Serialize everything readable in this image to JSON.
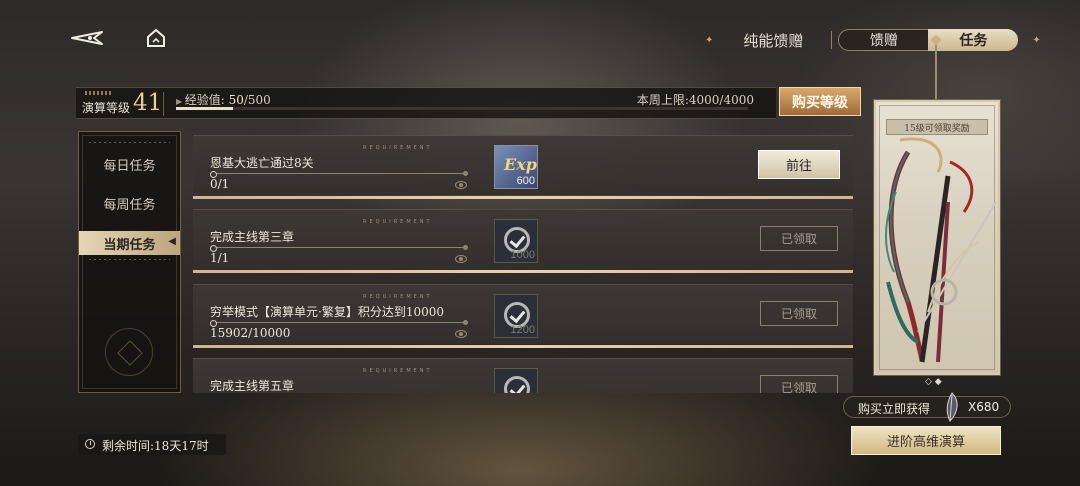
{
  "top_tabs": {
    "chip_energy": "纯能馈赠",
    "gift": "馈赠",
    "task": "任务"
  },
  "level": {
    "label": "演算等级",
    "value": "41"
  },
  "xp": {
    "label": "经验值:",
    "current": "50",
    "sep": "/",
    "max": "500",
    "progress": 0.1
  },
  "weekly": {
    "label": "本周上限:",
    "current": "4000",
    "sep": "/",
    "max": "4000"
  },
  "buy_level_label": "购买等级",
  "nav": [
    {
      "label": "每日任务"
    },
    {
      "label": "每周任务"
    },
    {
      "label": "当期任务"
    }
  ],
  "requirement_tag": "REQUIREMENT",
  "tasks": [
    {
      "name": "恩基大逃亡通过8关",
      "progress": "0/1",
      "reward_qty": "600",
      "reward_icon": "exp-icon",
      "action": "前往"
    },
    {
      "name": "完成主线第三章",
      "progress": "1/1",
      "reward_qty": "1000",
      "reward_icon": "points-icon",
      "action": "已领取"
    },
    {
      "name": "穷举模式【演算单元·繁复】积分达到10000",
      "progress": "15902/10000",
      "reward_qty": "1200",
      "reward_icon": "points-icon",
      "action": "已领取"
    },
    {
      "name": "完成主线第五章",
      "progress": "",
      "reward_qty": "",
      "reward_icon": "points-icon",
      "action": "已领取"
    }
  ],
  "reward_panel": {
    "title": "15级可领取奖励",
    "dots": "◇ ◆"
  },
  "buy_bonus": {
    "label": "购买立即获得",
    "qty": "X680"
  },
  "advance_label": "进阶高维演算",
  "remaining": {
    "label": "剩余时间:",
    "value": "18天17时"
  },
  "colors": {
    "accent_gold": "#c9a86a",
    "buy_button": "#d7a86a",
    "active_tab": "#e9dfc6"
  }
}
